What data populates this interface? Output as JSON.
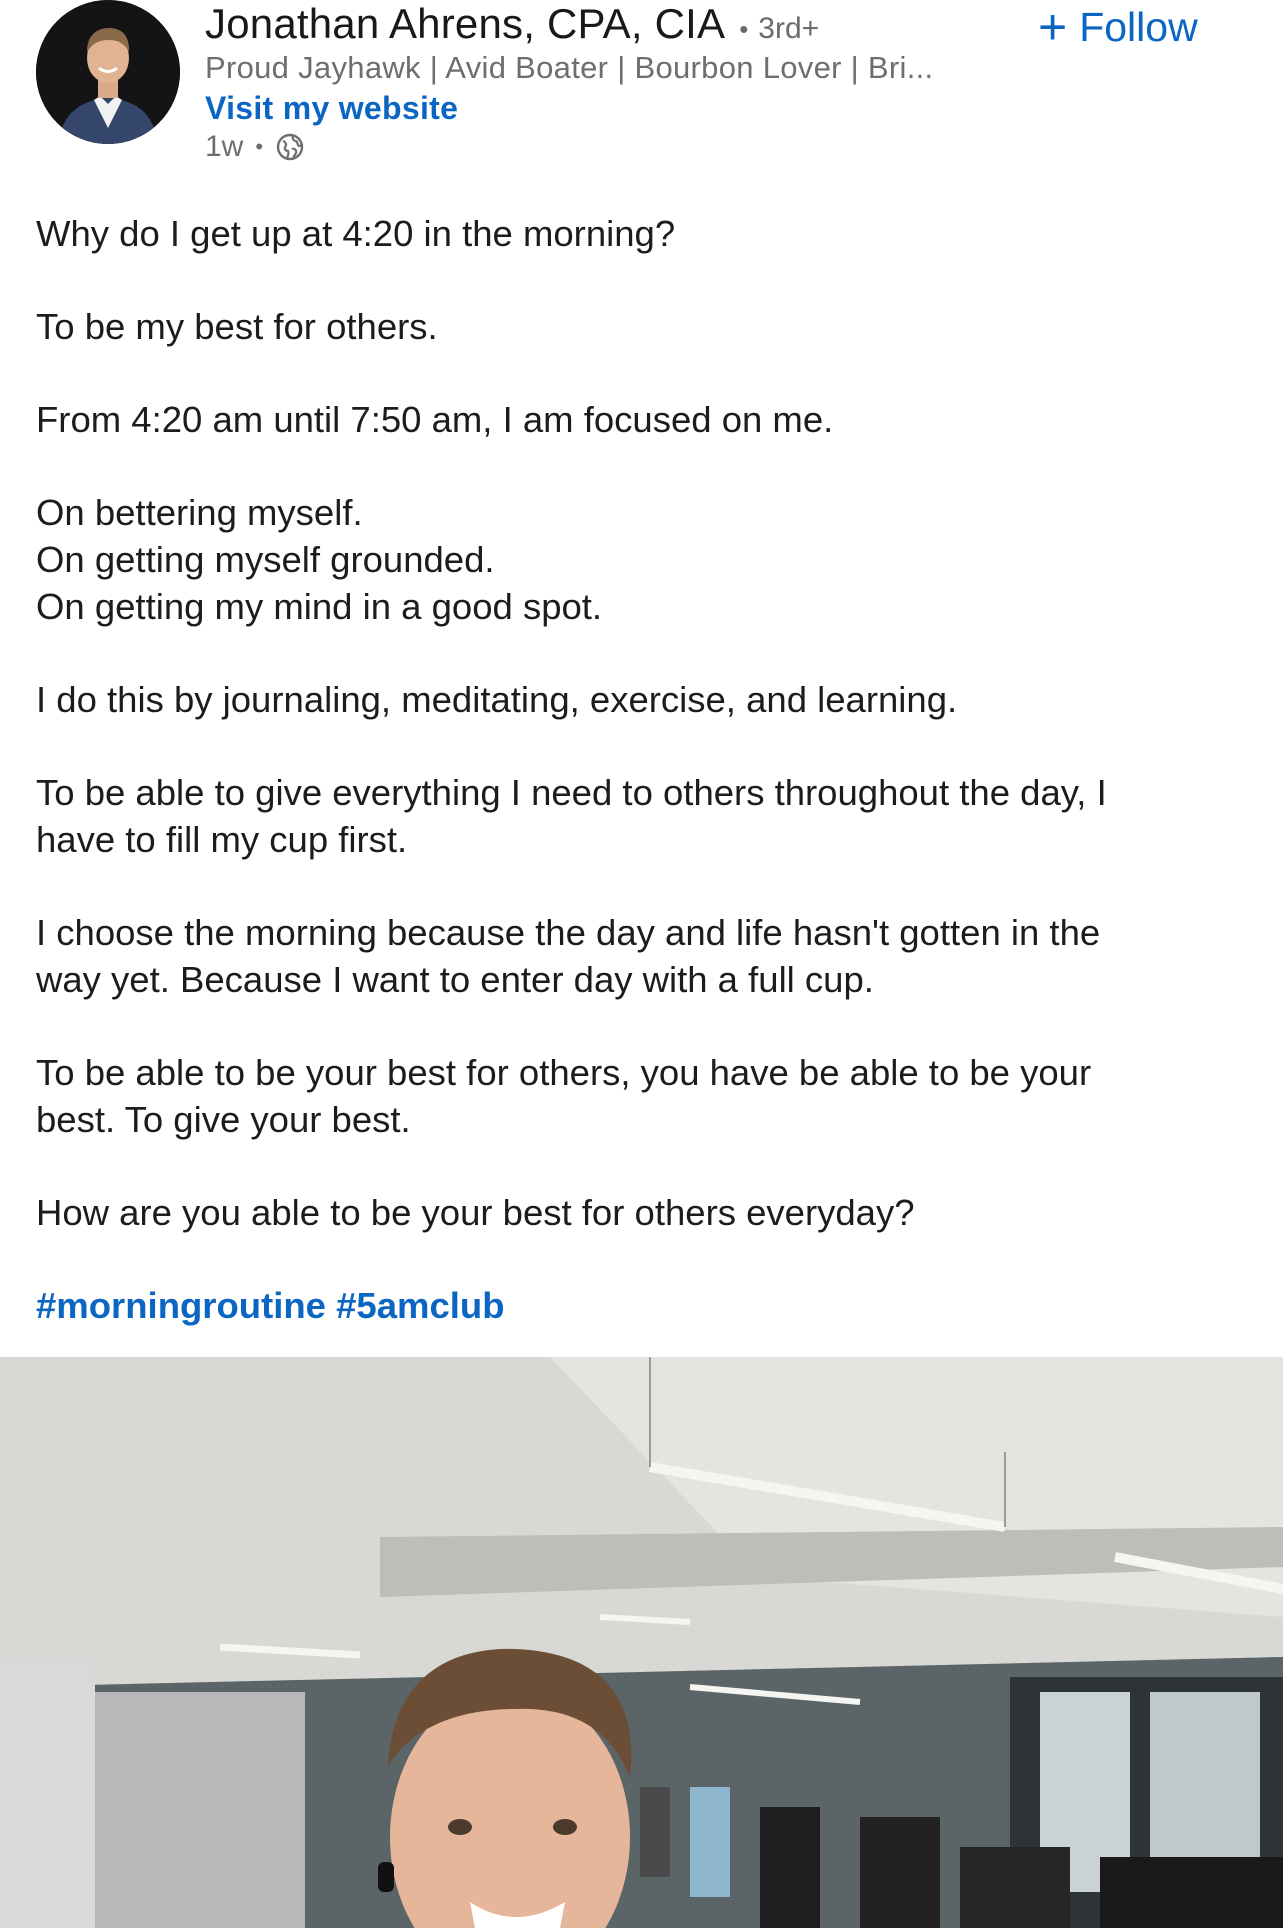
{
  "post": {
    "author": {
      "name": "Jonathan Ahrens, CPA, CIA",
      "separator": "•",
      "degree": "3rd+",
      "headline": "Proud Jayhawk | Avid Boater | Bourbon Lover | Bri...",
      "website_link": "Visit my website",
      "time_ago": "1w",
      "meta_separator": "•",
      "visibility_icon": "globe-icon"
    },
    "follow_button": {
      "icon": "+",
      "label": "Follow"
    },
    "body": {
      "p1": "Why do I get up at 4:20 in the morning?",
      "p2": "To be my best for others.",
      "p3": "From 4:20 am until 7:50 am, I am focused on me.",
      "p4_l1": "On bettering myself.",
      "p4_l2": "On getting myself grounded.",
      "p4_l3": "On getting my mind in a good spot.",
      "p5": "I do this by journaling, meditating, exercise, and learning.",
      "p6_l1": "To be able to give everything I need to others throughout the day, I",
      "p6_l2": "have to fill my cup first.",
      "p7_l1": "I choose the morning because the day and life hasn't gotten in the",
      "p7_l2": "way yet.  Because I want to enter day with a full cup.",
      "p8_l1": "To be able to be your best for others, you have be able to be your",
      "p8_l2": "best.  To give your best.",
      "p9": "How are you able to be your best for others everyday?"
    },
    "hashtags": [
      "#morningroutine",
      "#5amclub"
    ]
  },
  "colors": {
    "link_blue": "#0a66c2",
    "text": "#1c1c1c",
    "secondary_text": "#6e6e6e"
  }
}
